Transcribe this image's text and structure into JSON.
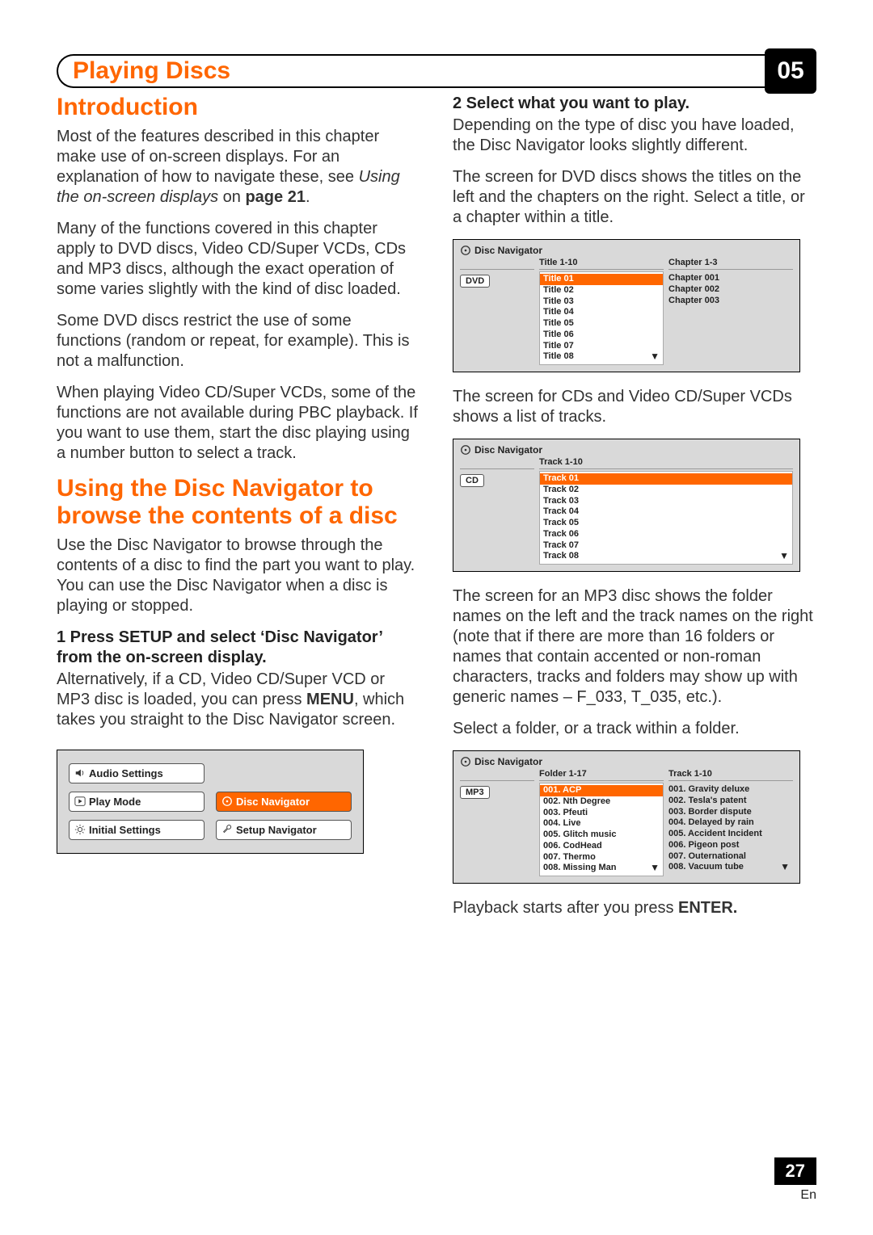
{
  "header": {
    "title": "Playing Discs",
    "chapter": "05"
  },
  "left": {
    "h_intro": "Introduction",
    "p1a": "Most of the features described in this chapter make use of on-screen displays. For an explanation of how to navigate these, see ",
    "p1b_italic": "Using the on-screen displays",
    "p1c": " on ",
    "p1d_bold": "page 21",
    "p1e": ".",
    "p2": "Many of the functions covered in this chapter apply to DVD discs, Video CD/Super VCDs, CDs and MP3 discs, although the exact operation of some varies slightly with the kind of disc loaded.",
    "p3": "Some DVD discs restrict the use of some functions (random or repeat, for example). This is not a malfunction.",
    "p4": "When playing Video CD/Super VCDs, some of the functions are not available during PBC playback. If you want to use them, start the disc playing using a number button to select a track.",
    "h_nav": "Using the Disc Navigator to browse the contents of a disc",
    "p5": "Use the Disc Navigator to browse through the contents of a disc to find the part you want to play. You can use the Disc Navigator when a disc is playing or stopped.",
    "step1": "1    Press SETUP and select ‘Disc Navigator’ from the on-screen display.",
    "p6a": "Alternatively, if a CD, Video CD/Super VCD or MP3 disc is loaded, you can press ",
    "p6b_bold": "MENU",
    "p6c": ", which takes you straight to the Disc Navigator screen.",
    "menu": {
      "audio": "Audio Settings",
      "play": "Play Mode",
      "discnav": "Disc Navigator",
      "initial": "Initial Settings",
      "setup": "Setup Navigator"
    }
  },
  "right": {
    "step2": "2    Select what you want to play.",
    "p7": "Depending on the type of disc you have loaded, the Disc Navigator looks slightly different.",
    "p8": "The screen for DVD discs shows the titles on the left and the chapters on the right. Select a title, or a chapter within a title.",
    "nav_label": "Disc Navigator",
    "dvd": {
      "tag": "DVD",
      "col1_head": "Title 1-10",
      "col2_head": "Chapter 1-3",
      "titles": [
        "Title 01",
        "Title 02",
        "Title 03",
        "Title 04",
        "Title 05",
        "Title 06",
        "Title 07",
        "Title 08"
      ],
      "chapters": [
        "Chapter 001",
        "Chapter 002",
        "Chapter 003"
      ]
    },
    "p9": "The screen for CDs and Video CD/Super VCDs shows a list of tracks.",
    "cd": {
      "tag": "CD",
      "col1_head": "Track 1-10",
      "tracks": [
        "Track 01",
        "Track 02",
        "Track 03",
        "Track 04",
        "Track 05",
        "Track 06",
        "Track 07",
        "Track 08"
      ]
    },
    "p10": "The screen for an MP3 disc shows the folder names on the left and the track names on the right (note that if there are more than 16 folders or names that contain accented or non-roman characters, tracks and folders may show up with generic names – F_033, T_035, etc.).",
    "p11": "Select a folder, or a track within a folder.",
    "mp3": {
      "tag": "MP3",
      "col1_head": "Folder 1-17",
      "col2_head": "Track 1-10",
      "folders": [
        "001. ACP",
        "002. Nth Degree",
        "003. Pfeuti",
        "004. Live",
        "005. Glitch music",
        "006. CodHead",
        "007. Thermo",
        "008. Missing Man"
      ],
      "tracks": [
        "001. Gravity deluxe",
        "002. Tesla's patent",
        "003. Border dispute",
        "004. Delayed by rain",
        "005. Accident Incident",
        "006. Pigeon post",
        "007. Outernational",
        "008. Vacuum tube"
      ]
    },
    "p12a": "Playback starts after you press ",
    "p12b_bold": "ENTER.",
    "page_num": "27",
    "lang": "En"
  }
}
